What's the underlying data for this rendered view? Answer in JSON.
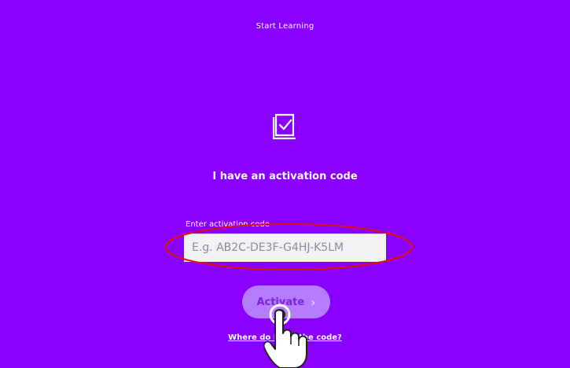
{
  "header": {
    "title": "Start Learning"
  },
  "main": {
    "icon": "book-check-icon",
    "heading": "I have an activation code",
    "field_label": "Enter activation code",
    "input_value": "",
    "input_placeholder": "E.g. AB2C-DE3F-G4HJ-K5LM",
    "activate_label": "Activate",
    "activate_chevron": "›",
    "help_link": "Where do I find the code?"
  },
  "overlay": {
    "annotation": "red-ellipse-highlight",
    "pointer": "hand-pointer-icon"
  },
  "colors": {
    "background": "#8a00ff",
    "button_bg": "#b57cff",
    "button_text": "#7a24d8",
    "input_bg": "#f2f2f4",
    "highlight": "#e01010"
  }
}
